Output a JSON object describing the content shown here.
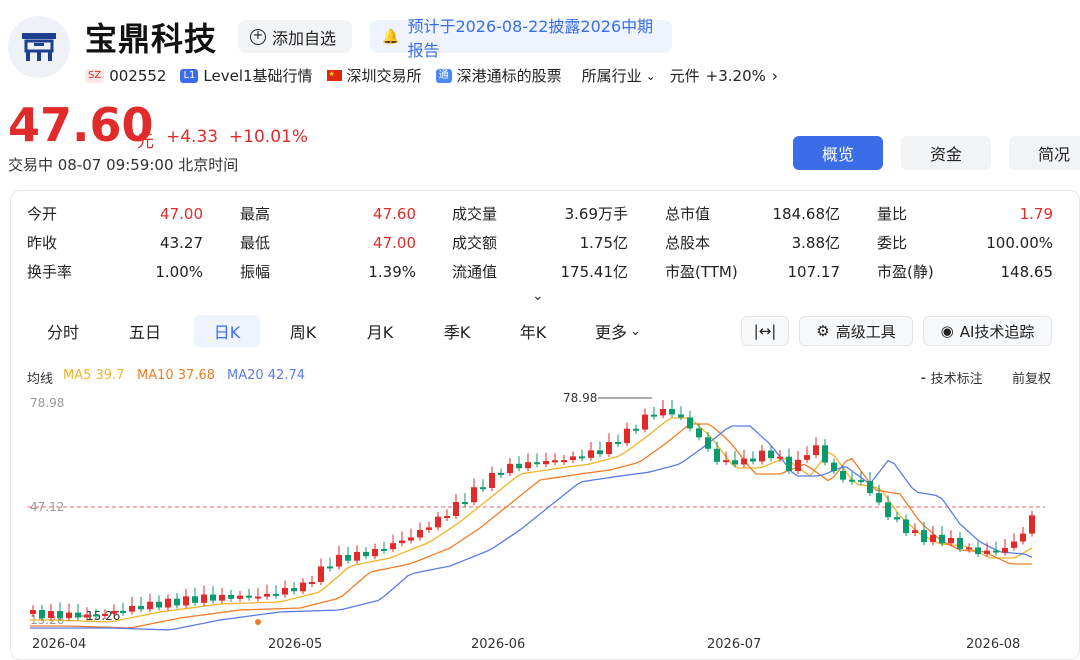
{
  "header": {
    "name": "宝鼎科技",
    "add_watch": "添加自选",
    "notice": "预计于2026-08-22披露2026中期报告",
    "market_badge": "SZ",
    "code": "002552",
    "level_badge": "L1",
    "level": "Level1基础行情",
    "exchange": "深圳交易所",
    "connect_badge": "通",
    "connect": "深港通标的股票",
    "industry_label": "所属行业",
    "industry": "元件",
    "industry_change": "+3.20%"
  },
  "quote": {
    "price": "47.60",
    "unit": "元",
    "change": "+4.33",
    "change_pct": "+10.01%",
    "status": "交易中  08-07 09:59:00 北京时间"
  },
  "view_tabs": [
    "概览",
    "资金",
    "简况"
  ],
  "stats": [
    {
      "label": "今开",
      "value": "47.00"
    },
    {
      "label": "最高",
      "value": "47.60"
    },
    {
      "label": "成交量",
      "value": "3.69万手"
    },
    {
      "label": "总市值",
      "value": "184.68亿"
    },
    {
      "label": "量比",
      "value": "1.79"
    },
    {
      "label": "昨收",
      "value": "43.27"
    },
    {
      "label": "最低",
      "value": "47.00"
    },
    {
      "label": "成交额",
      "value": "1.75亿"
    },
    {
      "label": "总股本",
      "value": "3.88亿"
    },
    {
      "label": "委比",
      "value": "100.00%"
    },
    {
      "label": "换手率",
      "value": "1.00%"
    },
    {
      "label": "振幅",
      "value": "1.39%"
    },
    {
      "label": "流通值",
      "value": "175.41亿"
    },
    {
      "label": "市盈(TTM)",
      "value": "107.17"
    },
    {
      "label": "市盈(静)",
      "value": "148.65"
    }
  ],
  "periods": [
    "分时",
    "五日",
    "日K",
    "周K",
    "月K",
    "季K",
    "年K",
    "更多"
  ],
  "tools": {
    "width": "|↔|",
    "advanced": "高级工具",
    "ai": "AI技术追踪"
  },
  "chart_labels": {
    "ma_label": "均线",
    "ma5": "MA5 39.7",
    "ma10": "MA10 37.68",
    "ma20": "MA20 42.74",
    "tech_mark": "技术标注",
    "adjust": "前复权",
    "y_top": "78.98",
    "y_mid": "47.12",
    "y_bottom": "15.26",
    "max_label": "78.98",
    "min_label": "15.26",
    "x_labels": [
      "2026-04",
      "2026-05",
      "2026-06",
      "2026-07",
      "2026-08"
    ]
  },
  "colors": {
    "up": "#e12a2a",
    "down": "#0a9a6e",
    "ma5": "#f0b429",
    "ma10": "#f07c28",
    "ma20": "#5b7be8",
    "accent": "#3b6de8"
  }
}
